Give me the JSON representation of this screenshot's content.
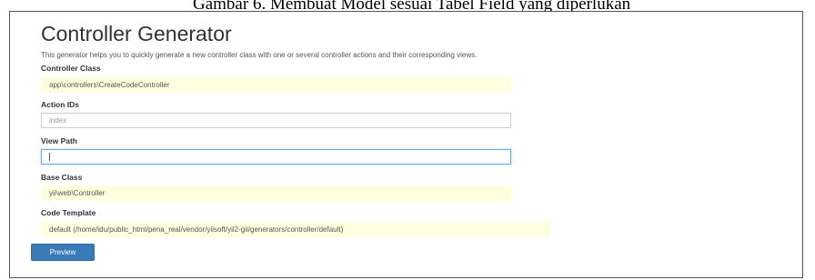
{
  "caption": "Gambar 6. Membuat Model sesuai Tabel Field yang diperlukan",
  "page_title": "Controller Generator",
  "description": "This generator helps you to quickly generate a new controller class with one or several controller actions and their corresponding views.",
  "fields": {
    "controller_class": {
      "label": "Controller Class",
      "value": "app\\controllers\\CreateCodeController"
    },
    "action_ids": {
      "label": "Action IDs",
      "value": "index"
    },
    "view_path": {
      "label": "View Path",
      "value": ""
    },
    "base_class": {
      "label": "Base Class",
      "value": "yii\\web\\Controller"
    },
    "code_template": {
      "label": "Code Template",
      "value": "default (/home/idu/public_html/pena_real/vendor/yiisoft/yii2-gii/generators/controller/default)"
    }
  },
  "buttons": {
    "preview_label": "Preview"
  },
  "colors": {
    "sticky_field_bg": "#ffffe0",
    "focus_border": "#66afe9",
    "primary_button": "#3a7ab7"
  }
}
